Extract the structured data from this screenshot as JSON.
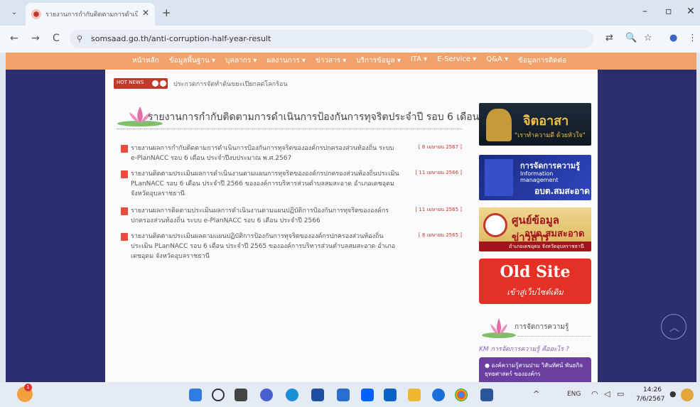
{
  "browser": {
    "tab_title": "รายงานการกำกับติดตามการดำเนินการ",
    "tab_close": "✕",
    "new_tab": "+",
    "menu": "⌄",
    "url": "somsaad.go.th/anti-corruption-half-year-result",
    "controls": {
      "minimize": "–",
      "maximize": "▫",
      "close": "✕"
    },
    "nav": {
      "back": "←",
      "forward": "→",
      "reload": "C",
      "site_info": "⚲"
    },
    "toolbar_icons": {
      "translate": "⇄",
      "zoom": "🔍",
      "bookmark": "☆",
      "profile": "●",
      "menu": "⋮"
    }
  },
  "site": {
    "nav_items": [
      "หน้าหลัก",
      "ข้อมูลพื้นฐาน ▾",
      "บุคลากร ▾",
      "ผลงานการ ▾",
      "ข่าวสาร ▾",
      "บริการข้อมูล ▾",
      "ITA ▾",
      "E-Service ▾",
      "Q&A ▾",
      "ข้อมูลการติดต่อ"
    ],
    "hot_news_label": "HOT NEWS",
    "ticker": "ประกวดการจัดทำต้นขยะเปียกลดโลกร้อน",
    "section_title": "รายงานการกำกับติดตามการดำเนินการป้องกันการทุจริตประจำปี รอบ 6 เดือน",
    "items": [
      {
        "text": "รายงานผลการกำกับติดตามการดำเนินการป้องกันการทุจริตขององค์กรปกครองส่วนท้องถิ่น ระบบ e-PlanNACC รอบ 6 เดือน ประจำปีงบประมาณ พ.ศ.2567",
        "date": "[ 8 เมษายน 2567 ]"
      },
      {
        "text": "รายงานติดตามประเมินผลการดำเนินงานตามแผนการทุจริตขององค์กรปกครองส่วนท้องถิ่นประเมิน PLanNACC รอบ 6 เดือน ประจำปี 2566 ขององค์การบริหารส่วนตำบลสมสะอาด อำเภอเดชอุดม จังหวัดอุบลราชธานี",
        "date": "[ 11 เมษายน 2566 ]"
      },
      {
        "text": "รายงานผลการติดตามประเมินผลการดำเนินงานตามแผนปฏิบัติการป้องกันการทุจริตขององค์กรปกครองส่วนท้องถิ่น ระบบ e-PlanNACC รอบ 6 เดือน ประจำปี 2566",
        "date": "[ 11 เมษายน 2565 ]"
      },
      {
        "text": "รายงานติดตามประเมินผลตามแผนปฏิบัติการป้องกันการทุจริตขององค์กรปกครองส่วนท้องถิ่นประเมิน PLanNACC รอบ 6 เดือน ประจำปี 2565 ขององค์การบริหารส่วนตำบลสมสะอาด อำเภอเดชอุดม จังหวัดอุบลราชธานี",
        "date": "[ 8 เมษายน 2565 ]"
      }
    ],
    "banners": {
      "b1": {
        "title": "จิตอาสา",
        "subtitle": "\"เราทำความดี ด้วยหัวใจ\""
      },
      "b2": {
        "title": "การจัดการความรู้",
        "subtitle": "Information management",
        "org": "อบต.สมสะอาด"
      },
      "b3": {
        "title": "ศูนย์ข้อมูลข่าวสาร",
        "org": "อบต.สมสะอาด",
        "subtitle": "อำเภอเดชอุดม จังหวัดอุบลราชธานี"
      },
      "b4": {
        "title": "Old Site",
        "subtitle": "เข้าสู่เว็บไซต์เดิม"
      }
    },
    "km": {
      "title": "การจัดการความรู้",
      "subtitle": "KM การจัดการความรู้ คืออะไร ?",
      "box_text": "● องค์ความรู้สวนปาม วิสันทัศน์ พันธกิจ ยุทธศาสตร์ ขององค์กร"
    },
    "scroll_top": "︿"
  },
  "taskbar": {
    "weather_badge": "1",
    "lang": "ENG",
    "time": "14:26",
    "date": "7/6/2567",
    "tray_up": "^"
  }
}
